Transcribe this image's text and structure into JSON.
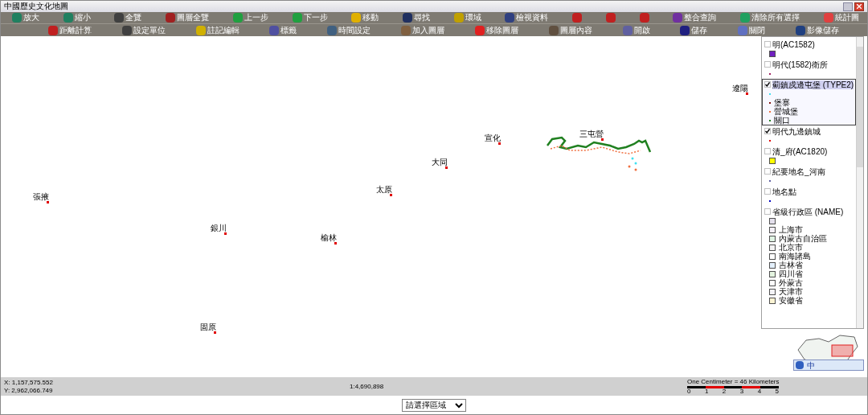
{
  "window": {
    "title": "中國歷史文化地圖"
  },
  "toolbar_top": [
    {
      "kind": "text",
      "label": "放大"
    },
    {
      "kind": "text",
      "label": "縮小"
    },
    {
      "kind": "text",
      "label": "全覽"
    },
    {
      "kind": "text",
      "label": "圖層全覽"
    },
    {
      "kind": "text",
      "label": "上一步"
    },
    {
      "kind": "text",
      "label": "下一步"
    },
    {
      "kind": "text",
      "label": "移動"
    },
    {
      "kind": "text",
      "label": "尋找"
    },
    {
      "kind": "text",
      "label": "環域"
    },
    {
      "kind": "text",
      "label": "檢視資料"
    },
    {
      "kind": "icon"
    },
    {
      "kind": "icon"
    },
    {
      "kind": "icon"
    },
    {
      "kind": "text",
      "label": "整合查詢"
    },
    {
      "kind": "text",
      "label": "清除所有選擇"
    },
    {
      "kind": "text",
      "label": "統計圖"
    }
  ],
  "toolbar_bottom": [
    "距離計算",
    "設定單位",
    "註記編輯",
    "標籤",
    "時間設定",
    "加入圖層",
    "移除圖層",
    "圖層內容",
    "開啟",
    "儲存",
    "關閉",
    "影像儲存"
  ],
  "map_labels": [
    "遼陽",
    "宣化",
    "大同",
    "太原",
    "張掖",
    "銀川",
    "榆林",
    "固原",
    "三屯營"
  ],
  "layers": [
    {
      "name": "明(AC1582)",
      "checked": false,
      "selected": false,
      "symbols": [
        {
          "kind": "square",
          "color": "#7020c0"
        }
      ]
    },
    {
      "name": "明代(1582)衛所",
      "checked": false,
      "selected": false,
      "symbols": [
        {
          "kind": "dot",
          "color": "#a02060"
        }
      ]
    },
    {
      "name": "薊鎮戍邊屯堡 (TYPE2)",
      "checked": true,
      "selected": true,
      "symbols": [
        {
          "kind": "dot",
          "color": "#40e0f0"
        },
        {
          "kind": "dot",
          "color": "#801010",
          "label": "堡寨"
        },
        {
          "kind": "dot",
          "color": "#f07040",
          "label": "營城堡"
        },
        {
          "kind": "dot",
          "color": "#208020",
          "label": "關口"
        }
      ]
    },
    {
      "name": "明代九邊鎮城",
      "checked": true,
      "selected": false,
      "symbols": [
        {
          "kind": "dot",
          "color": "#e00000"
        }
      ]
    },
    {
      "name": "清_府(AC1820)",
      "checked": false,
      "selected": false,
      "symbols": [
        {
          "kind": "square",
          "color": "#ffff00"
        }
      ]
    },
    {
      "name": "紀要地名_河南",
      "checked": false,
      "selected": false,
      "symbols": [
        {
          "kind": "dot",
          "color": "#6060a0"
        }
      ]
    },
    {
      "name": "地名點",
      "checked": false,
      "selected": false,
      "symbols": [
        {
          "kind": "dot",
          "color": "#0000c0"
        }
      ]
    },
    {
      "name": "省級行政區 (NAME)",
      "checked": false,
      "selected": false,
      "symbols": [
        {
          "kind": "square",
          "color": "#e4e0ec"
        },
        {
          "kind": "square",
          "color": "#f4f0f8",
          "label": "上海市"
        },
        {
          "kind": "square",
          "color": "#e0f4e4",
          "label": "內蒙古自治區"
        },
        {
          "kind": "square",
          "color": "#f4f4f4",
          "label": "北京市"
        },
        {
          "kind": "square",
          "color": "#ffffff",
          "label": "南海諸島"
        },
        {
          "kind": "square",
          "color": "#e4f0fc",
          "label": "吉林省"
        },
        {
          "kind": "square",
          "color": "#e4f4e0",
          "label": "四川省"
        },
        {
          "kind": "square",
          "color": "#fcfcfc",
          "label": "外蒙古"
        },
        {
          "kind": "square",
          "color": "#f4f4f8",
          "label": "天津市"
        },
        {
          "kind": "square",
          "color": "#fcf4d4",
          "label": "安徽省"
        }
      ]
    }
  ],
  "status": {
    "x": "X: 1,157,575.552",
    "y": "Y: 2,962,066.749",
    "scale": "1:4,690,898",
    "scale_caption": "One Centimeter = 46 Kilometers",
    "scale_ticks": [
      "0",
      "1",
      "2",
      "3",
      "4",
      "5"
    ]
  },
  "ime": "中",
  "region_select": {
    "value": "請選擇區域"
  }
}
